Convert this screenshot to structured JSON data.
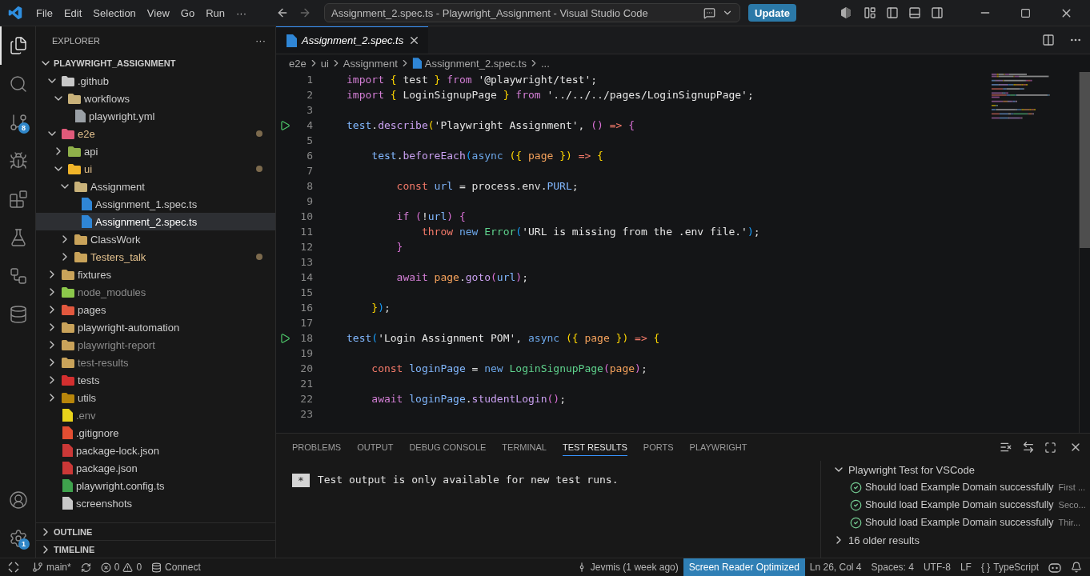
{
  "title_bar": {
    "menus": [
      "File",
      "Edit",
      "Selection",
      "View",
      "Go",
      "Run"
    ],
    "more": "···",
    "command_center": "Assignment_2.spec.ts - Playwright_Assignment - Visual Studio Code",
    "update_button": "Update"
  },
  "activity_bar": {
    "items": [
      {
        "kind": "explorer",
        "selected": true
      },
      {
        "kind": "search",
        "selected": false
      },
      {
        "kind": "source-control",
        "selected": false,
        "badge": "8"
      },
      {
        "kind": "run-debug",
        "selected": false
      },
      {
        "kind": "extensions",
        "selected": false
      },
      {
        "kind": "testing",
        "selected": false
      },
      {
        "kind": "remote",
        "selected": false
      },
      {
        "kind": "database",
        "selected": false
      }
    ],
    "bottom": [
      {
        "kind": "account"
      },
      {
        "kind": "settings",
        "badge": "1"
      }
    ]
  },
  "sidebar": {
    "title": "EXPLORER",
    "more": "···",
    "root": {
      "label": "PLAYWRIGHT_ASSIGNMENT",
      "expanded": true
    },
    "tree": [
      {
        "label": ".github",
        "kind": "folder",
        "color": "#c8c8c8",
        "expanded": true,
        "modified": false,
        "ignored": false,
        "selected": false,
        "children": [
          {
            "label": "workflows",
            "kind": "folder",
            "color": "#c9b27a",
            "expanded": true,
            "modified": false,
            "ignored": false,
            "selected": false,
            "children": [
              {
                "label": "playwright.yml",
                "kind": "file",
                "color": "#9aa0a6",
                "modified": false,
                "ignored": false,
                "selected": false
              }
            ]
          }
        ]
      },
      {
        "label": "e2e",
        "kind": "folder",
        "color": "#e05a7a",
        "expanded": true,
        "modified": true,
        "ignored": false,
        "selected": false,
        "children": [
          {
            "label": "api",
            "kind": "folder",
            "color": "#8fb04a",
            "expanded": false,
            "modified": false,
            "ignored": false,
            "selected": false
          },
          {
            "label": "ui",
            "kind": "folder",
            "color": "#f0b429",
            "expanded": true,
            "modified": true,
            "ignored": false,
            "selected": false,
            "children": [
              {
                "label": "Assignment",
                "kind": "folder",
                "color": "#c9b27a",
                "expanded": true,
                "modified": false,
                "ignored": false,
                "selected": false,
                "children": [
                  {
                    "label": "Assignment_1.spec.ts",
                    "kind": "file",
                    "color": "#2f86d6",
                    "modified": false,
                    "ignored": false,
                    "selected": false
                  },
                  {
                    "label": "Assignment_2.spec.ts",
                    "kind": "file",
                    "color": "#2f86d6",
                    "modified": false,
                    "ignored": false,
                    "selected": true
                  }
                ]
              },
              {
                "label": "ClassWork",
                "kind": "folder",
                "color": "#c9a35a",
                "expanded": false,
                "modified": false,
                "ignored": false,
                "selected": false
              },
              {
                "label": "Testers_talk",
                "kind": "folder",
                "color": "#c9a35a",
                "expanded": false,
                "modified": true,
                "ignored": false,
                "selected": false
              }
            ]
          }
        ]
      },
      {
        "label": "fixtures",
        "kind": "folder",
        "color": "#c9a35a",
        "expanded": false,
        "modified": false,
        "ignored": false,
        "selected": false
      },
      {
        "label": "node_modules",
        "kind": "folder",
        "color": "#8cc84b",
        "expanded": false,
        "modified": false,
        "ignored": true,
        "selected": false
      },
      {
        "label": "pages",
        "kind": "folder",
        "color": "#e2583e",
        "expanded": false,
        "modified": false,
        "ignored": false,
        "selected": false
      },
      {
        "label": "playwright-automation",
        "kind": "folder",
        "color": "#c9a35a",
        "expanded": false,
        "modified": false,
        "ignored": false,
        "selected": false
      },
      {
        "label": "playwright-report",
        "kind": "folder",
        "color": "#c9a35a",
        "expanded": false,
        "modified": false,
        "ignored": true,
        "selected": false
      },
      {
        "label": "test-results",
        "kind": "folder",
        "color": "#c9a35a",
        "expanded": false,
        "modified": false,
        "ignored": true,
        "selected": false
      },
      {
        "label": "tests",
        "kind": "folder",
        "color": "#d32f2f",
        "expanded": false,
        "modified": false,
        "ignored": false,
        "selected": false
      },
      {
        "label": "utils",
        "kind": "folder",
        "color": "#b8860b",
        "expanded": false,
        "modified": false,
        "ignored": false,
        "selected": false
      },
      {
        "label": ".env",
        "kind": "file",
        "color": "#e8d31b",
        "modified": false,
        "ignored": true,
        "selected": false
      },
      {
        "label": ".gitignore",
        "kind": "file",
        "color": "#e24e32",
        "modified": false,
        "ignored": false,
        "selected": false
      },
      {
        "label": "package-lock.json",
        "kind": "file",
        "color": "#cb3837",
        "modified": false,
        "ignored": false,
        "selected": false
      },
      {
        "label": "package.json",
        "kind": "file",
        "color": "#cb3837",
        "modified": false,
        "ignored": false,
        "selected": false
      },
      {
        "label": "playwright.config.ts",
        "kind": "file",
        "color": "#3fa34d",
        "modified": false,
        "ignored": false,
        "selected": false
      },
      {
        "label": "screenshots",
        "kind": "file",
        "color": "#c8c8c8",
        "modified": false,
        "ignored": false,
        "selected": false
      }
    ],
    "sections": [
      {
        "label": "OUTLINE",
        "expanded": false
      },
      {
        "label": "TIMELINE",
        "expanded": false
      }
    ]
  },
  "editor": {
    "tabs": [
      {
        "label": "Assignment_2.spec.ts",
        "selected": true
      }
    ],
    "breadcrumbs": [
      {
        "label": "e2e",
        "kind": "folder"
      },
      {
        "label": "ui",
        "kind": "folder"
      },
      {
        "label": "Assignment",
        "kind": "folder"
      },
      {
        "label": "Assignment_2.spec.ts",
        "kind": "file"
      },
      {
        "label": "...",
        "kind": "more"
      }
    ],
    "lines": [
      {
        "number": "1",
        "runnable": false,
        "tokens": [
          {
            "text": "import",
            "kind": "keyword"
          },
          {
            "text": " {",
            "kind": "bracket1"
          },
          {
            "text": " test ",
            "kind": "plain"
          },
          {
            "text": "}",
            "kind": "bracket1"
          },
          {
            "text": " from",
            "kind": "keyword"
          },
          {
            "text": " '@playwright/test'",
            "kind": "string"
          },
          {
            "text": ";",
            "kind": "plain"
          }
        ]
      },
      {
        "number": "2",
        "runnable": false,
        "tokens": [
          {
            "text": "import",
            "kind": "keyword"
          },
          {
            "text": " {",
            "kind": "bracket1"
          },
          {
            "text": " LoginSignupPage ",
            "kind": "plain"
          },
          {
            "text": "}",
            "kind": "bracket1"
          },
          {
            "text": " from",
            "kind": "keyword"
          },
          {
            "text": " '../../../pages/LoginSignupPage'",
            "kind": "string"
          },
          {
            "text": ";",
            "kind": "plain"
          }
        ]
      },
      {
        "number": "3",
        "runnable": false
      },
      {
        "number": "4",
        "runnable": true,
        "tokens": [
          {
            "text": "test",
            "kind": "variable"
          },
          {
            "text": ".",
            "kind": "plain"
          },
          {
            "text": "describe",
            "kind": "function"
          },
          {
            "text": "(",
            "kind": "bracket1"
          },
          {
            "text": "'Playwright Assignment'",
            "kind": "string"
          },
          {
            "text": ", ",
            "kind": "plain"
          },
          {
            "text": "()",
            "kind": "bracket2"
          },
          {
            "text": " =>",
            "kind": "operator"
          },
          {
            "text": " {",
            "kind": "bracket2"
          }
        ]
      },
      {
        "number": "5",
        "runnable": false
      },
      {
        "number": "6",
        "runnable": false,
        "tokens": [
          {
            "text": "    test",
            "kind": "variable"
          },
          {
            "text": ".",
            "kind": "plain"
          },
          {
            "text": "beforeEach",
            "kind": "function"
          },
          {
            "text": "(",
            "kind": "bracket3"
          },
          {
            "text": "async",
            "kind": "storage"
          },
          {
            "text": " ({",
            "kind": "bracket1"
          },
          {
            "text": " page ",
            "kind": "parameter"
          },
          {
            "text": "})",
            "kind": "bracket1"
          },
          {
            "text": " =>",
            "kind": "operator"
          },
          {
            "text": " {",
            "kind": "bracket1"
          }
        ]
      },
      {
        "number": "7",
        "runnable": false
      },
      {
        "number": "8",
        "runnable": false,
        "tokens": [
          {
            "text": "        const",
            "kind": "operator"
          },
          {
            "text": " url",
            "kind": "variable"
          },
          {
            "text": " = process.env.",
            "kind": "plain"
          },
          {
            "text": "PURL",
            "kind": "variable"
          },
          {
            "text": ";",
            "kind": "plain"
          }
        ]
      },
      {
        "number": "9",
        "runnable": false
      },
      {
        "number": "10",
        "runnable": false,
        "tokens": [
          {
            "text": "        if",
            "kind": "keyword"
          },
          {
            "text": " (",
            "kind": "bracket2"
          },
          {
            "text": "!",
            "kind": "plain"
          },
          {
            "text": "url",
            "kind": "variable"
          },
          {
            "text": ")",
            "kind": "bracket2"
          },
          {
            "text": " {",
            "kind": "bracket2"
          }
        ]
      },
      {
        "number": "11",
        "runnable": false,
        "tokens": [
          {
            "text": "            throw",
            "kind": "operator"
          },
          {
            "text": " new",
            "kind": "storage"
          },
          {
            "text": " Error",
            "kind": "class"
          },
          {
            "text": "(",
            "kind": "bracket3"
          },
          {
            "text": "'URL is missing from the .env file.'",
            "kind": "string"
          },
          {
            "text": ")",
            "kind": "bracket3"
          },
          {
            "text": ";",
            "kind": "plain"
          }
        ]
      },
      {
        "number": "12",
        "runnable": false,
        "tokens": [
          {
            "text": "        }",
            "kind": "bracket2"
          }
        ]
      },
      {
        "number": "13",
        "runnable": false
      },
      {
        "number": "14",
        "runnable": false,
        "tokens": [
          {
            "text": "        await",
            "kind": "keyword"
          },
          {
            "text": " page",
            "kind": "parameter"
          },
          {
            "text": ".",
            "kind": "plain"
          },
          {
            "text": "goto",
            "kind": "function"
          },
          {
            "text": "(",
            "kind": "bracket2"
          },
          {
            "text": "url",
            "kind": "variable"
          },
          {
            "text": ")",
            "kind": "bracket2"
          },
          {
            "text": ";",
            "kind": "plain"
          }
        ]
      },
      {
        "number": "15",
        "runnable": false
      },
      {
        "number": "16",
        "runnable": false,
        "tokens": [
          {
            "text": "    }",
            "kind": "bracket1"
          },
          {
            "text": ")",
            "kind": "bracket3"
          },
          {
            "text": ";",
            "kind": "plain"
          }
        ]
      },
      {
        "number": "17",
        "runnable": false
      },
      {
        "number": "18",
        "runnable": true,
        "tokens": [
          {
            "text": "test",
            "kind": "variable"
          },
          {
            "text": "(",
            "kind": "bracket3"
          },
          {
            "text": "'Login Assignment POM'",
            "kind": "string"
          },
          {
            "text": ", ",
            "kind": "plain"
          },
          {
            "text": "async",
            "kind": "storage"
          },
          {
            "text": " ({",
            "kind": "bracket1"
          },
          {
            "text": " page ",
            "kind": "parameter"
          },
          {
            "text": "})",
            "kind": "bracket1"
          },
          {
            "text": " =>",
            "kind": "operator"
          },
          {
            "text": " {",
            "kind": "bracket1"
          }
        ]
      },
      {
        "number": "19",
        "runnable": false
      },
      {
        "number": "20",
        "runnable": false,
        "tokens": [
          {
            "text": "    const",
            "kind": "operator"
          },
          {
            "text": " loginPage",
            "kind": "variable"
          },
          {
            "text": " = ",
            "kind": "plain"
          },
          {
            "text": "new",
            "kind": "storage"
          },
          {
            "text": " LoginSignupPage",
            "kind": "class"
          },
          {
            "text": "(",
            "kind": "bracket2"
          },
          {
            "text": "page",
            "kind": "parameter"
          },
          {
            "text": ")",
            "kind": "bracket2"
          },
          {
            "text": ";",
            "kind": "plain"
          }
        ]
      },
      {
        "number": "21",
        "runnable": false
      },
      {
        "number": "22",
        "runnable": false,
        "tokens": [
          {
            "text": "    await",
            "kind": "keyword"
          },
          {
            "text": " loginPage",
            "kind": "variable"
          },
          {
            "text": ".",
            "kind": "plain"
          },
          {
            "text": "studentLogin",
            "kind": "function"
          },
          {
            "text": "()",
            "kind": "bracket2"
          },
          {
            "text": ";",
            "kind": "plain"
          }
        ]
      },
      {
        "number": "23",
        "runnable": false
      }
    ]
  },
  "panel": {
    "tabs": [
      {
        "label": "PROBLEMS",
        "selected": false
      },
      {
        "label": "OUTPUT",
        "selected": false
      },
      {
        "label": "DEBUG CONSOLE",
        "selected": false
      },
      {
        "label": "TERMINAL",
        "selected": false
      },
      {
        "label": "TEST RESULTS",
        "selected": true
      },
      {
        "label": "PORTS",
        "selected": false
      },
      {
        "label": "PLAYWRIGHT",
        "selected": false
      }
    ],
    "output": {
      "marker": "*",
      "message": "Test output is only available for new test runs."
    },
    "results": {
      "group": {
        "label": "Playwright Test for VSCode",
        "expanded": true
      },
      "items": [
        {
          "name": "Should load Example Domain successfully",
          "detail": "First ...",
          "passed": true
        },
        {
          "name": "Should load Example Domain successfully",
          "detail": "Seco...",
          "passed": true
        },
        {
          "name": "Should load Example Domain successfully",
          "detail": "Thir...",
          "passed": true
        }
      ],
      "older": "16 older results"
    }
  },
  "status_bar": {
    "branch": "main*",
    "errors": "0",
    "warnings": "0",
    "connect": "Connect",
    "commit": "Jevmis (1 week ago)",
    "screen_reader": "Screen Reader Optimized",
    "position": "Ln 26, Col 4",
    "spaces": "Spaces: 4",
    "encoding": "UTF-8",
    "eol": "LF",
    "language_icon": "{ }",
    "language": "TypeScript"
  }
}
